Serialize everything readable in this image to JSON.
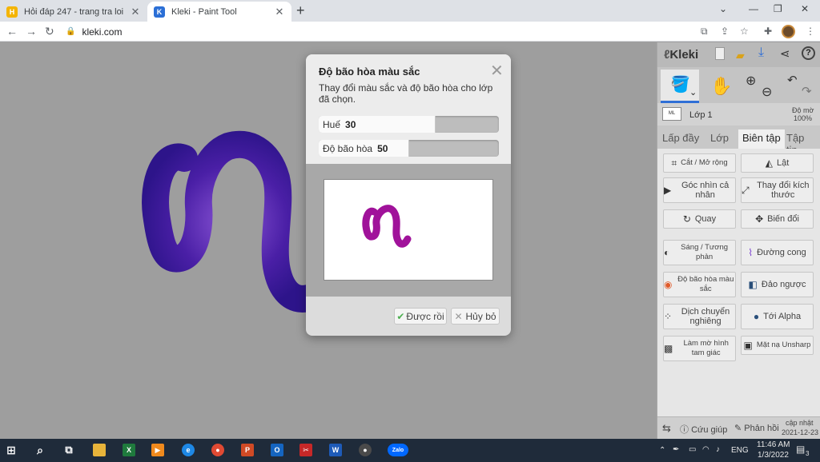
{
  "browser": {
    "tabs": [
      {
        "title": "Hỏi đáp 247 - trang tra loi",
        "active": false,
        "favicon_color": "#f4b400"
      },
      {
        "title": "Kleki - Paint Tool",
        "active": true,
        "favicon_color": "#2b6fd6"
      }
    ],
    "url": "kleki.com"
  },
  "app": {
    "logo": "Kleki",
    "layer_name": "Lớp 1",
    "opacity_label": "Độ mờ",
    "opacity_value": "100%",
    "tabs": [
      "Lấp đầy",
      "Lớp",
      "Biên tập",
      "Tập tin"
    ],
    "active_tab": "Biên tập",
    "edit_buttons": [
      {
        "label": "Cắt / Mở rộng",
        "icon": "crop-icon"
      },
      {
        "label": "Lật",
        "icon": "flip-icon"
      },
      {
        "label": "Góc nhìn cả nhân",
        "icon": "perspective-icon"
      },
      {
        "label": "Thay đổi kích thước",
        "icon": "resize-icon"
      },
      {
        "label": "Quay",
        "icon": "rotate-icon"
      },
      {
        "label": "Biến đổi",
        "icon": "transform-icon"
      },
      {
        "label": "Sáng / Tương phản",
        "icon": "brightness-icon"
      },
      {
        "label": "Đường cong",
        "icon": "curves-icon"
      },
      {
        "label": "Độ bão hòa màu sắc",
        "icon": "hue-saturation-icon"
      },
      {
        "label": "Đảo ngược",
        "icon": "invert-icon"
      },
      {
        "label": "Dịch chuyển nghiêng",
        "icon": "tilt-shift-icon"
      },
      {
        "label": "Tới Alpha",
        "icon": "to-alpha-icon"
      },
      {
        "label": "Làm mờ hình tam giác",
        "icon": "triangle-blur-icon"
      },
      {
        "label": "Mặt nạ Unsharp",
        "icon": "unsharp-mask-icon"
      }
    ],
    "footer": {
      "help": "Cứu giúp",
      "feedback": "Phản hồi",
      "update_label": "cập nhật",
      "update_date": "2021-12-23"
    }
  },
  "dialog": {
    "title": "Độ bão hòa màu sắc",
    "description": "Thay đổi màu sắc và độ bão hòa cho lớp đã chọn.",
    "sliders": [
      {
        "label": "Huế",
        "value": "30",
        "fraction": 0.65
      },
      {
        "label": "Độ bão hòa",
        "value": "50",
        "fraction": 0.5
      }
    ],
    "ok_label": "Được rồi",
    "cancel_label": "Hủy bỏ"
  },
  "taskbar": {
    "time": "11:46 AM",
    "date": "1/3/2022",
    "language": "ENG",
    "notifications": "3"
  },
  "colors": {
    "stroke_canvas": "#3a1a8c",
    "stroke_preview": "#a0129a",
    "accent": "#2f6fd6"
  }
}
